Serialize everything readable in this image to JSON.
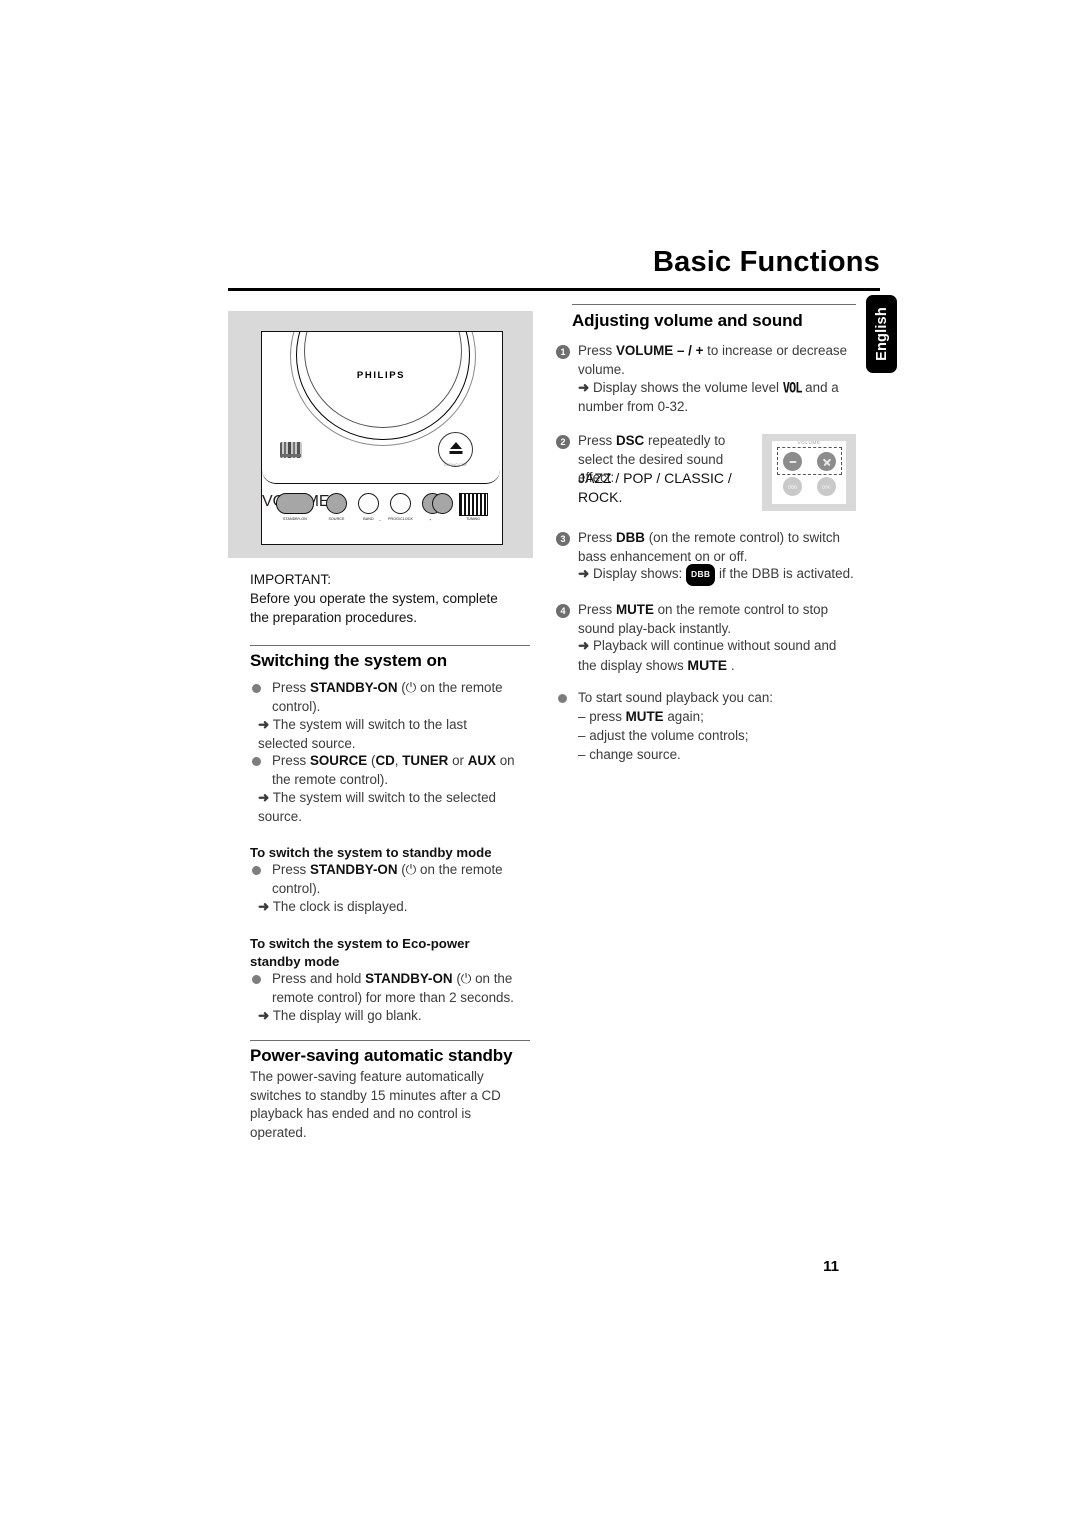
{
  "header": {
    "title": "Basic Functions",
    "language_tab": "English"
  },
  "figure_device": {
    "brand": "PHILIPS",
    "cd_logo": "compact-disc-digital-audio",
    "eject_label": "OPEN•CLOSE",
    "buttons": [
      {
        "label": "STANDBY-ON"
      },
      {
        "label": "SOURCE"
      },
      {
        "label": "BAND"
      },
      {
        "label": "PROG/CLOCK"
      },
      {
        "label": "VOLUME"
      },
      {
        "label": "TUNING"
      }
    ],
    "volume_minus": "–",
    "volume_plus": "+",
    "tuning_caption": "TUNING"
  },
  "left_column": {
    "important": {
      "heading": "IMPORTANT:",
      "text": "Before you operate the system, complete the preparation procedures."
    },
    "switching": {
      "heading": "Switching the system on",
      "items": [
        {
          "pre": "Press ",
          "bold": "STANDBY-ON",
          "post": " (⏻ on the remote control).",
          "result": "The system will switch to the last selected source."
        },
        {
          "pre": "Press ",
          "bold": "SOURCE",
          "post_parts": [
            " (",
            "CD",
            ", ",
            "TUNER",
            " or ",
            "AUX",
            " on the remote control)."
          ],
          "result": "The system will switch to the selected source."
        }
      ],
      "standby_subhead": "To switch the system to standby mode",
      "standby_item": {
        "pre": "Press ",
        "bold": "STANDBY-ON",
        "post": " (⏻ on the remote control).",
        "result": "The clock is displayed."
      },
      "eco_subhead_line1": "To switch the system to Eco-power",
      "eco_subhead_line2": "standby mode",
      "eco_item": {
        "pre": "Press and hold ",
        "bold": "STANDBY-ON",
        "post": " (⏻ on the remote control) for more than 2 seconds.",
        "result": "The display will go blank."
      }
    },
    "power_saving": {
      "heading": "Power-saving automatic standby",
      "text": "The power-saving feature automatically switches to standby 15 minutes after a CD playback has ended and no control is operated."
    }
  },
  "right_column": {
    "heading": "Adjusting volume and sound",
    "steps": [
      {
        "num": "1",
        "pre": "Press ",
        "bold": "VOLUME – / +",
        "post": " to increase or decrease volume.",
        "result_pre": "Display shows the volume level ",
        "result_lcd": "VOL",
        "result_post": " and a number from 0-32."
      },
      {
        "num": "2",
        "pre": "Press ",
        "bold": "DSC",
        "post": " repeatedly to select the desired sound effect:",
        "effects": "JAZZ / POP / CLASSIC / ROCK."
      },
      {
        "num": "3",
        "pre": "Press ",
        "bold": "DBB",
        "post": " (on the remote control) to switch bass enhancement on or off.",
        "result_pre": "Display shows: ",
        "result_badge": "DBB",
        "result_post": " if the DBB is activated."
      },
      {
        "num": "4",
        "pre": "Press ",
        "bold": "MUTE",
        "post": " on the remote control to stop sound play-back instantly.",
        "result_pre": "Playback will continue without sound and the display shows ",
        "result_bold": "MUTE",
        "result_post": " ."
      }
    ],
    "start_playback": {
      "intro": "To start sound playback you can:",
      "options": [
        {
          "dash": "–",
          "pre": "press ",
          "bold": "MUTE",
          "post": " again;"
        },
        {
          "dash": "–",
          "pre": "adjust the volume controls;",
          "bold": "",
          "post": ""
        },
        {
          "dash": "–",
          "pre": "change source.",
          "bold": "",
          "post": ""
        }
      ]
    }
  },
  "figure_remote": {
    "volume_label": "VOLUME",
    "buttons": [
      {
        "label": "–"
      },
      {
        "label": "+"
      },
      {
        "label": "DBB"
      },
      {
        "label": "DSC"
      }
    ]
  },
  "footer": {
    "page_number": "11"
  }
}
